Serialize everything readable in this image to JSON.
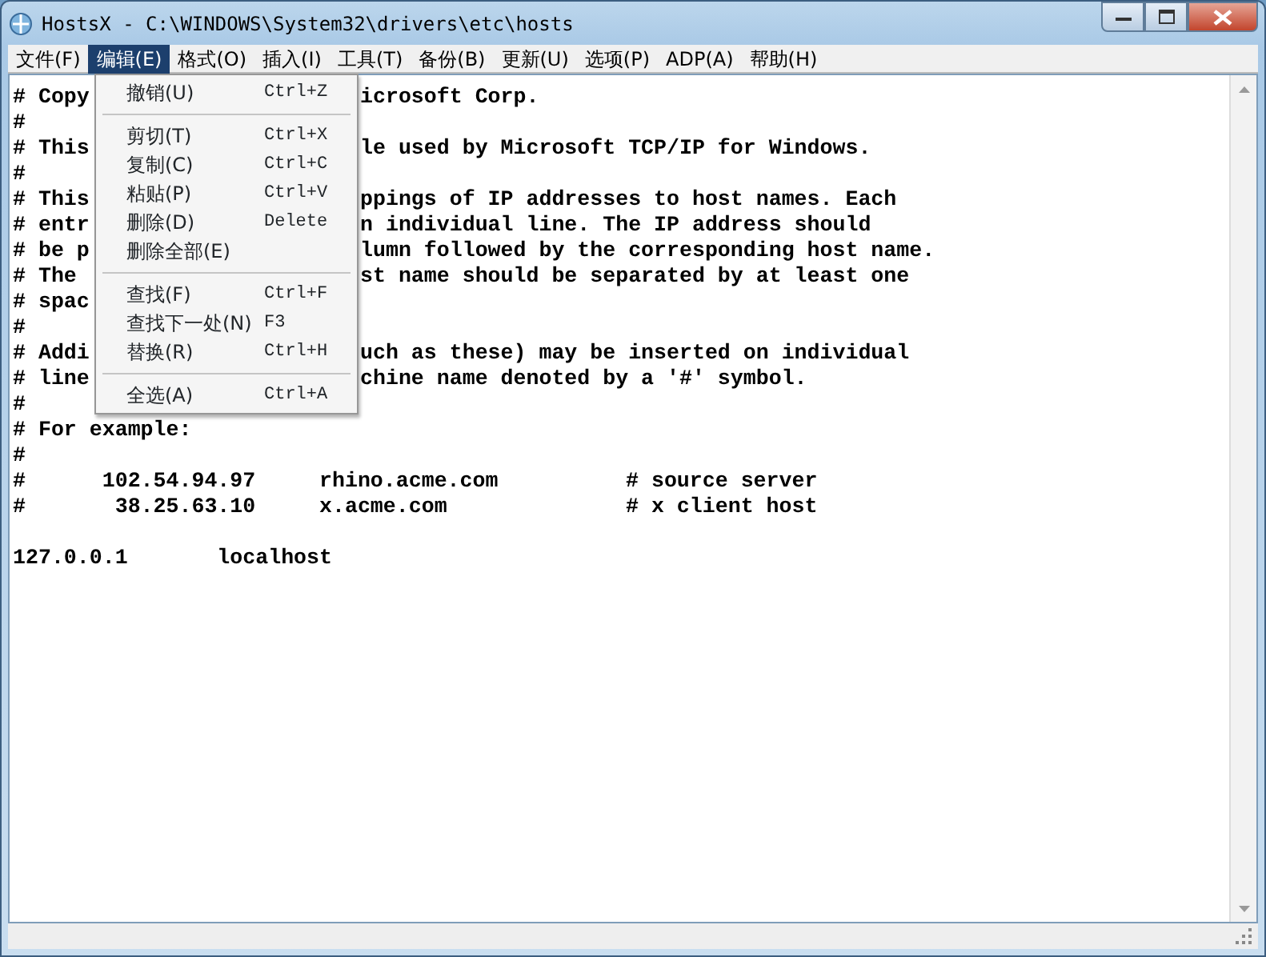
{
  "window": {
    "title": "HostsX - C:\\WINDOWS\\System32\\drivers\\etc\\hosts"
  },
  "menu_bar": [
    {
      "label": "文件(F)",
      "selected": false
    },
    {
      "label": "编辑(E)",
      "selected": true
    },
    {
      "label": "格式(O)",
      "selected": false
    },
    {
      "label": "插入(I)",
      "selected": false
    },
    {
      "label": "工具(T)",
      "selected": false
    },
    {
      "label": "备份(B)",
      "selected": false
    },
    {
      "label": "更新(U)",
      "selected": false
    },
    {
      "label": "选项(P)",
      "selected": false
    },
    {
      "label": "ADP(A)",
      "selected": false
    },
    {
      "label": "帮助(H)",
      "selected": false
    }
  ],
  "edit_menu": [
    {
      "kind": "item",
      "label": "撤销(U)",
      "shortcut": "Ctrl+Z"
    },
    {
      "kind": "separator"
    },
    {
      "kind": "item",
      "label": "剪切(T)",
      "shortcut": "Ctrl+X"
    },
    {
      "kind": "item",
      "label": "复制(C)",
      "shortcut": "Ctrl+C"
    },
    {
      "kind": "item",
      "label": "粘贴(P)",
      "shortcut": "Ctrl+V"
    },
    {
      "kind": "item",
      "label": "删除(D)",
      "shortcut": "Delete"
    },
    {
      "kind": "item",
      "label": "删除全部(E)"
    },
    {
      "kind": "separator"
    },
    {
      "kind": "item",
      "label": "查找(F)",
      "shortcut": "Ctrl+F"
    },
    {
      "kind": "item",
      "label": "查找下一处(N)",
      "shortcut": "F3"
    },
    {
      "kind": "item",
      "label": "替换(R)",
      "shortcut": "Ctrl+H"
    },
    {
      "kind": "separator"
    },
    {
      "kind": "item",
      "label": "全选(A)",
      "shortcut": "Ctrl+A"
    }
  ],
  "editor_lines": [
    {
      "kind": "split",
      "left": "# Copy",
      "right": "icrosoft Corp."
    },
    {
      "kind": "full",
      "text": "#"
    },
    {
      "kind": "split",
      "left": "# This",
      "right": "le used by Microsoft TCP/IP for Windows."
    },
    {
      "kind": "full",
      "text": "#"
    },
    {
      "kind": "split",
      "left": "# This",
      "right": "ppings of IP addresses to host names. Each"
    },
    {
      "kind": "split",
      "left": "# entr",
      "right": "n individual line. The IP address should"
    },
    {
      "kind": "split",
      "left": "# be p",
      "right": "lumn followed by the corresponding host name."
    },
    {
      "kind": "split",
      "left": "# The",
      "right": "st name should be separated by at least one"
    },
    {
      "kind": "split",
      "left": "# spac"
    },
    {
      "kind": "full",
      "text": "#"
    },
    {
      "kind": "split",
      "left": "# Addi",
      "right": "uch as these) may be inserted on individual"
    },
    {
      "kind": "split",
      "left": "# line",
      "right": "chine name denoted by a '#' symbol."
    },
    {
      "kind": "full",
      "text": "#"
    },
    {
      "kind": "full",
      "text": "# For example:"
    },
    {
      "kind": "full",
      "text": "#"
    },
    {
      "kind": "full",
      "text": "#      102.54.94.97     rhino.acme.com          # source server"
    },
    {
      "kind": "full",
      "text": "#       38.25.63.10     x.acme.com              # x client host"
    },
    {
      "kind": "blank"
    },
    {
      "kind": "full",
      "text": "127.0.0.1       localhost"
    }
  ]
}
